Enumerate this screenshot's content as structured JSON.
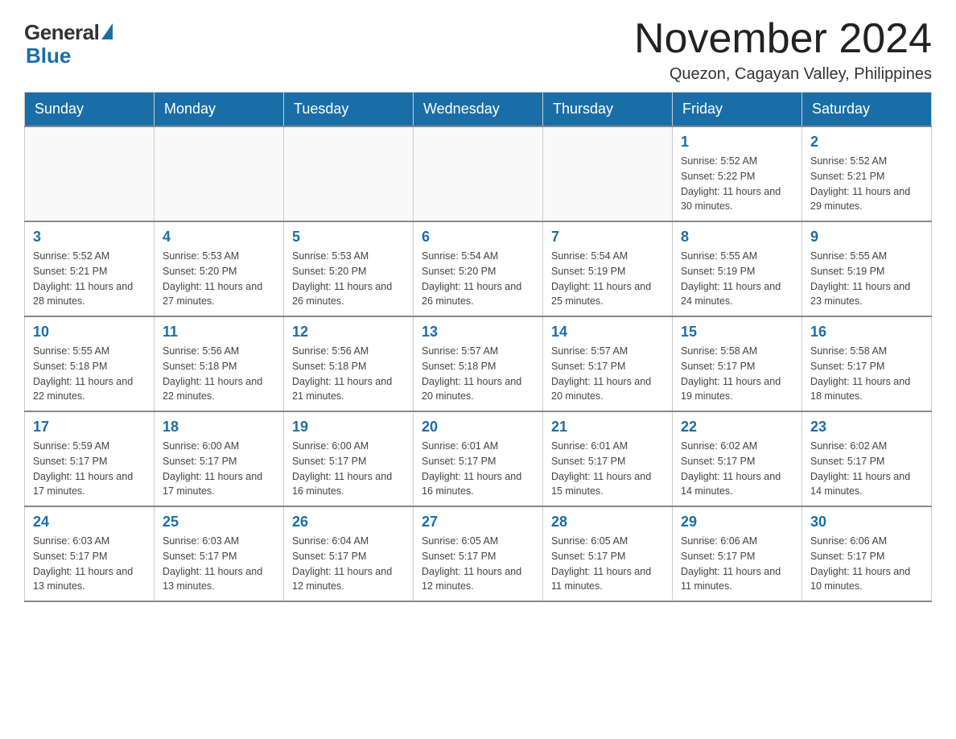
{
  "logo": {
    "general": "General",
    "blue": "Blue"
  },
  "header": {
    "title": "November 2024",
    "location": "Quezon, Cagayan Valley, Philippines"
  },
  "weekdays": [
    "Sunday",
    "Monday",
    "Tuesday",
    "Wednesday",
    "Thursday",
    "Friday",
    "Saturday"
  ],
  "weeks": [
    [
      {
        "day": "",
        "info": ""
      },
      {
        "day": "",
        "info": ""
      },
      {
        "day": "",
        "info": ""
      },
      {
        "day": "",
        "info": ""
      },
      {
        "day": "",
        "info": ""
      },
      {
        "day": "1",
        "info": "Sunrise: 5:52 AM\nSunset: 5:22 PM\nDaylight: 11 hours and 30 minutes."
      },
      {
        "day": "2",
        "info": "Sunrise: 5:52 AM\nSunset: 5:21 PM\nDaylight: 11 hours and 29 minutes."
      }
    ],
    [
      {
        "day": "3",
        "info": "Sunrise: 5:52 AM\nSunset: 5:21 PM\nDaylight: 11 hours and 28 minutes."
      },
      {
        "day": "4",
        "info": "Sunrise: 5:53 AM\nSunset: 5:20 PM\nDaylight: 11 hours and 27 minutes."
      },
      {
        "day": "5",
        "info": "Sunrise: 5:53 AM\nSunset: 5:20 PM\nDaylight: 11 hours and 26 minutes."
      },
      {
        "day": "6",
        "info": "Sunrise: 5:54 AM\nSunset: 5:20 PM\nDaylight: 11 hours and 26 minutes."
      },
      {
        "day": "7",
        "info": "Sunrise: 5:54 AM\nSunset: 5:19 PM\nDaylight: 11 hours and 25 minutes."
      },
      {
        "day": "8",
        "info": "Sunrise: 5:55 AM\nSunset: 5:19 PM\nDaylight: 11 hours and 24 minutes."
      },
      {
        "day": "9",
        "info": "Sunrise: 5:55 AM\nSunset: 5:19 PM\nDaylight: 11 hours and 23 minutes."
      }
    ],
    [
      {
        "day": "10",
        "info": "Sunrise: 5:55 AM\nSunset: 5:18 PM\nDaylight: 11 hours and 22 minutes."
      },
      {
        "day": "11",
        "info": "Sunrise: 5:56 AM\nSunset: 5:18 PM\nDaylight: 11 hours and 22 minutes."
      },
      {
        "day": "12",
        "info": "Sunrise: 5:56 AM\nSunset: 5:18 PM\nDaylight: 11 hours and 21 minutes."
      },
      {
        "day": "13",
        "info": "Sunrise: 5:57 AM\nSunset: 5:18 PM\nDaylight: 11 hours and 20 minutes."
      },
      {
        "day": "14",
        "info": "Sunrise: 5:57 AM\nSunset: 5:17 PM\nDaylight: 11 hours and 20 minutes."
      },
      {
        "day": "15",
        "info": "Sunrise: 5:58 AM\nSunset: 5:17 PM\nDaylight: 11 hours and 19 minutes."
      },
      {
        "day": "16",
        "info": "Sunrise: 5:58 AM\nSunset: 5:17 PM\nDaylight: 11 hours and 18 minutes."
      }
    ],
    [
      {
        "day": "17",
        "info": "Sunrise: 5:59 AM\nSunset: 5:17 PM\nDaylight: 11 hours and 17 minutes."
      },
      {
        "day": "18",
        "info": "Sunrise: 6:00 AM\nSunset: 5:17 PM\nDaylight: 11 hours and 17 minutes."
      },
      {
        "day": "19",
        "info": "Sunrise: 6:00 AM\nSunset: 5:17 PM\nDaylight: 11 hours and 16 minutes."
      },
      {
        "day": "20",
        "info": "Sunrise: 6:01 AM\nSunset: 5:17 PM\nDaylight: 11 hours and 16 minutes."
      },
      {
        "day": "21",
        "info": "Sunrise: 6:01 AM\nSunset: 5:17 PM\nDaylight: 11 hours and 15 minutes."
      },
      {
        "day": "22",
        "info": "Sunrise: 6:02 AM\nSunset: 5:17 PM\nDaylight: 11 hours and 14 minutes."
      },
      {
        "day": "23",
        "info": "Sunrise: 6:02 AM\nSunset: 5:17 PM\nDaylight: 11 hours and 14 minutes."
      }
    ],
    [
      {
        "day": "24",
        "info": "Sunrise: 6:03 AM\nSunset: 5:17 PM\nDaylight: 11 hours and 13 minutes."
      },
      {
        "day": "25",
        "info": "Sunrise: 6:03 AM\nSunset: 5:17 PM\nDaylight: 11 hours and 13 minutes."
      },
      {
        "day": "26",
        "info": "Sunrise: 6:04 AM\nSunset: 5:17 PM\nDaylight: 11 hours and 12 minutes."
      },
      {
        "day": "27",
        "info": "Sunrise: 6:05 AM\nSunset: 5:17 PM\nDaylight: 11 hours and 12 minutes."
      },
      {
        "day": "28",
        "info": "Sunrise: 6:05 AM\nSunset: 5:17 PM\nDaylight: 11 hours and 11 minutes."
      },
      {
        "day": "29",
        "info": "Sunrise: 6:06 AM\nSunset: 5:17 PM\nDaylight: 11 hours and 11 minutes."
      },
      {
        "day": "30",
        "info": "Sunrise: 6:06 AM\nSunset: 5:17 PM\nDaylight: 11 hours and 10 minutes."
      }
    ]
  ]
}
